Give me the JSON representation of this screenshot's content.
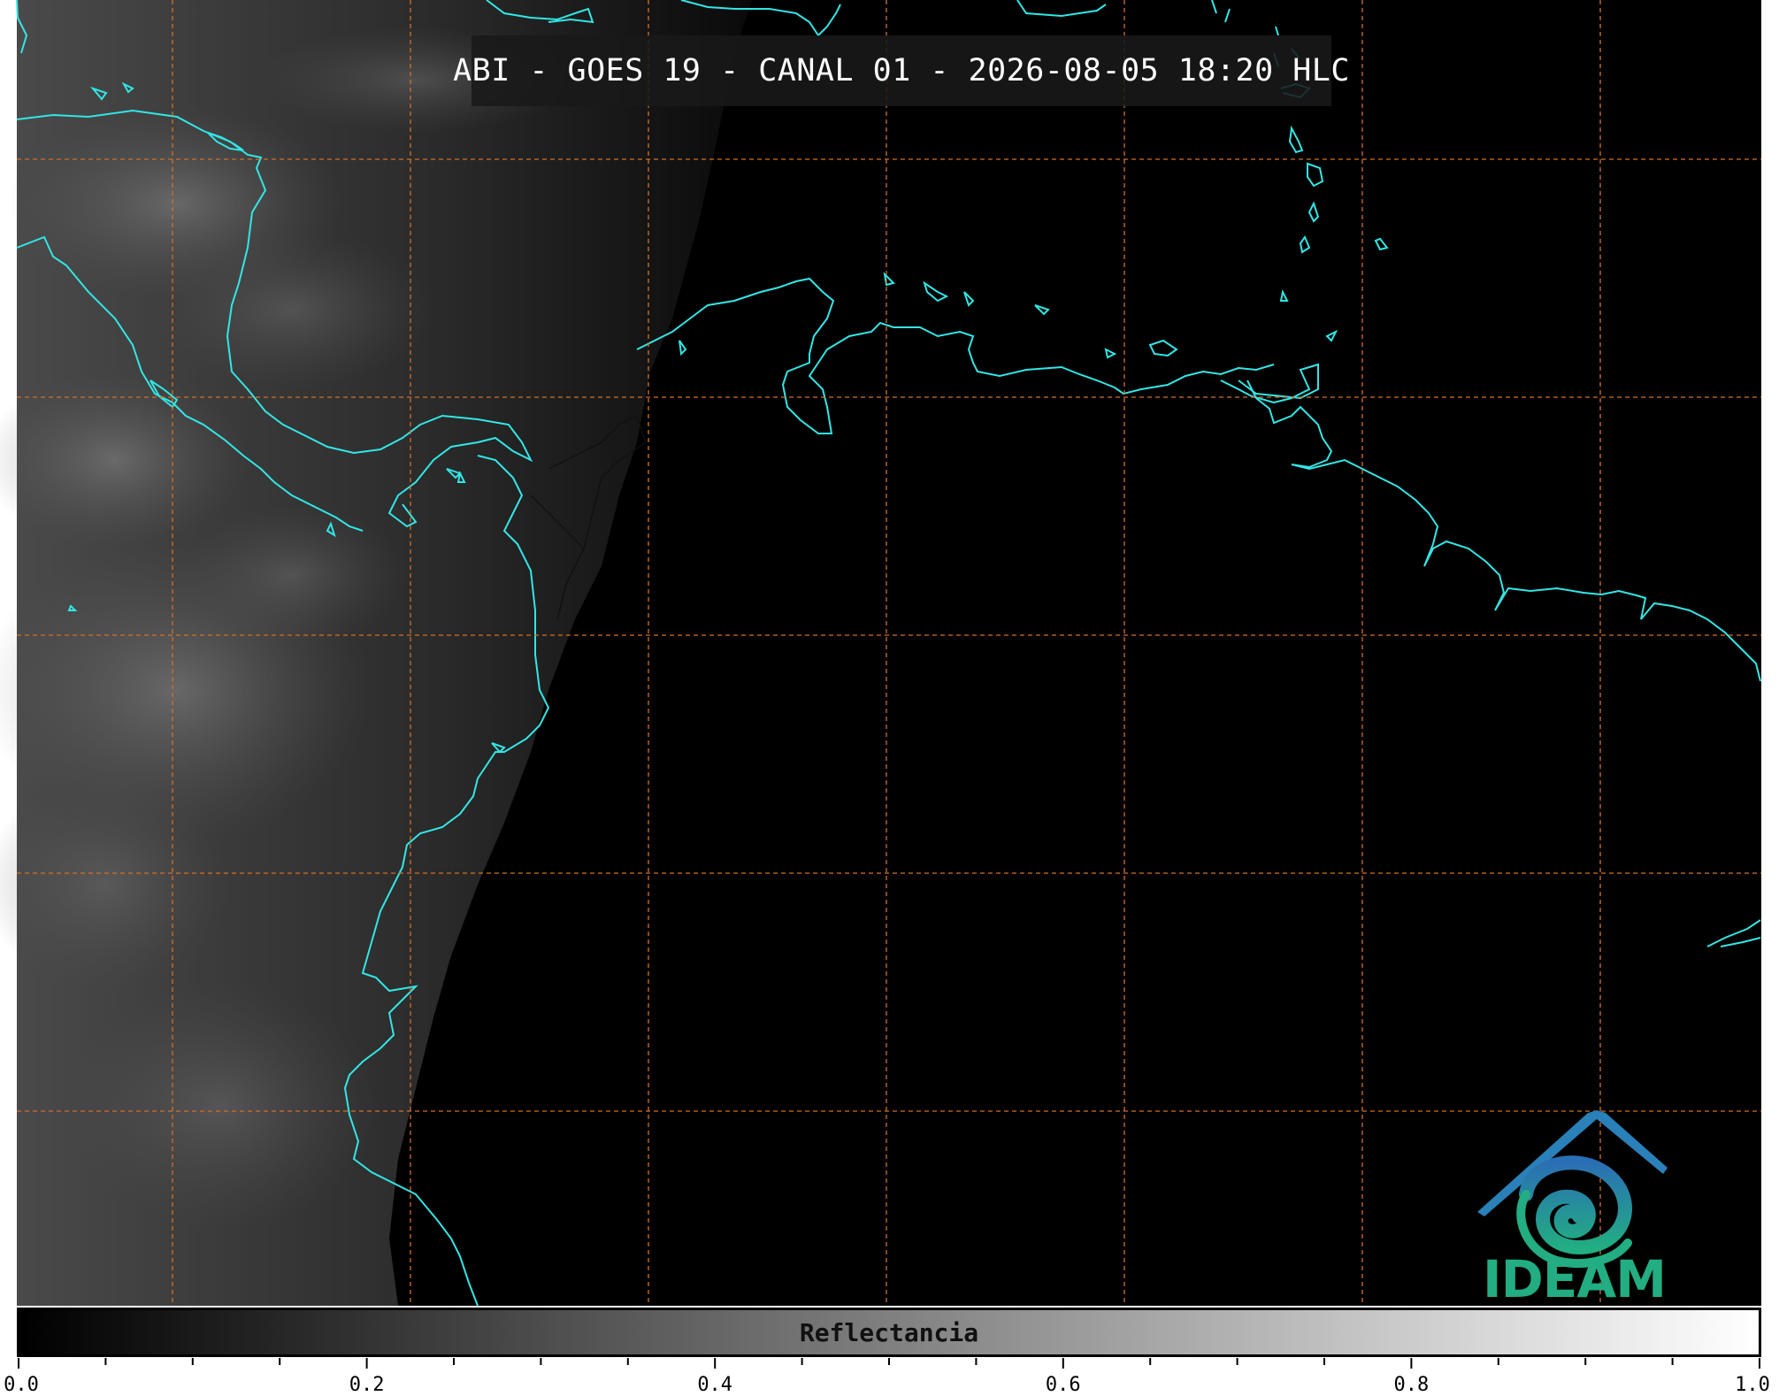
{
  "title": "ABI - GOES 19 - CANAL 01 - 2026-08-05 18:20 HLC",
  "logo": {
    "text": "IDEAM",
    "colors": [
      "#2a6fb5",
      "#22ad82"
    ]
  },
  "colorbar": {
    "label": "Reflectancia",
    "colormap": [
      "#000000",
      "#ffffff"
    ],
    "range": [
      0.0,
      1.0
    ],
    "tick_labels": [
      "0.0",
      "0.2",
      "0.4",
      "0.6",
      "0.8",
      "1.0"
    ],
    "minor_ticks_between": 3
  },
  "map": {
    "coastline_color": "#33e6e6",
    "gridline_color": "#d0702a",
    "gridline_style": "dashed",
    "background": "#000000"
  }
}
